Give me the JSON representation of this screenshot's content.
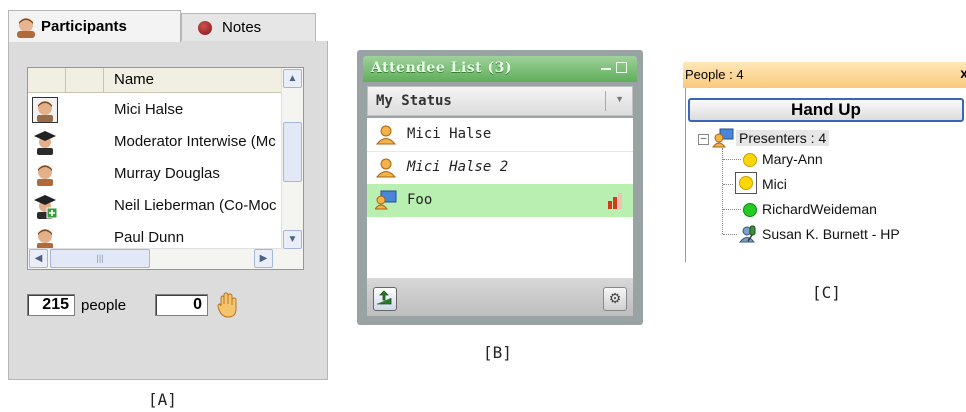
{
  "panel_a": {
    "tabs": [
      {
        "label": "Participants"
      },
      {
        "label": "Notes"
      }
    ],
    "column_header": "Name",
    "participants": [
      {
        "name": "Mici Halse",
        "icon": "person-selected-icon"
      },
      {
        "name": "Moderator Interwise (Mc",
        "icon": "moderator-graduate-icon"
      },
      {
        "name": "Murray Douglas",
        "icon": "person-icon"
      },
      {
        "name": "Neil Lieberman (Co-Moc",
        "icon": "co-moderator-graduate-icon"
      },
      {
        "name": "Paul Dunn",
        "icon": "person-icon"
      }
    ],
    "people_count": "215",
    "people_label": "people",
    "hands_count": "0",
    "caption": "[A]"
  },
  "panel_b": {
    "title": "Attendee List (3)",
    "status_label": "My Status",
    "attendees": [
      {
        "name": "Mici Halse",
        "italic": false,
        "highlighted": false
      },
      {
        "name": "Mici Halse 2",
        "italic": true,
        "highlighted": false
      },
      {
        "name": "Foo",
        "italic": false,
        "highlighted": true
      }
    ],
    "caption": "[B]"
  },
  "panel_c": {
    "header": "People : 4",
    "close_glyph": "x",
    "hand_up_label": "Hand Up",
    "group_label": "Presenters : 4",
    "people": [
      {
        "name": "Mary-Ann",
        "status_color": "#ffd700"
      },
      {
        "name": "Mici",
        "status_color": "#ffd700"
      },
      {
        "name": "RichardWeideman",
        "status_color": "#22cc22"
      },
      {
        "name": "Susan K. Burnett - HP",
        "status_color": "none"
      }
    ],
    "caption": "[C]"
  }
}
